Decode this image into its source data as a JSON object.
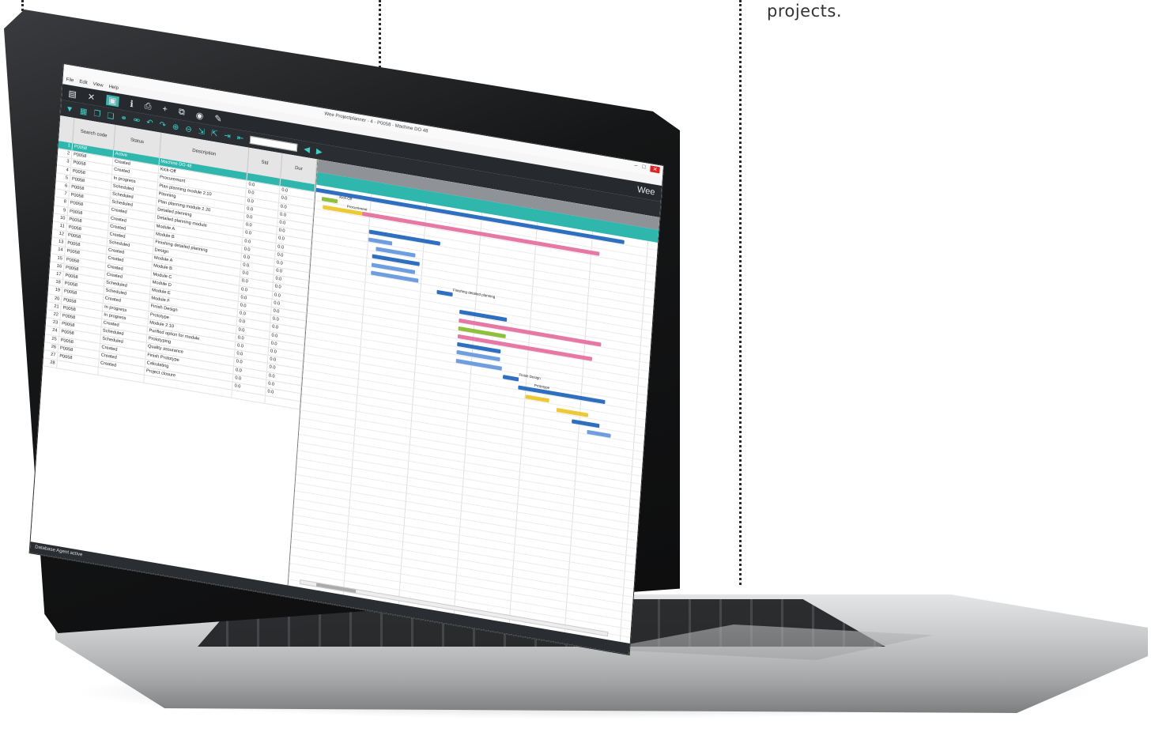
{
  "caption": {
    "tail_text": "projects."
  },
  "app": {
    "window_title": "Wee Projectplanner - 4 - P0058 - Machine DO 48",
    "brand": "Wee",
    "menu": [
      "File",
      "Edit",
      "View",
      "Help"
    ],
    "toolbar_primary": [
      "save",
      "close",
      "view",
      "info",
      "print",
      "add",
      "copy",
      "eye",
      "edit"
    ],
    "toolbar_secondary": [
      "filter",
      "table",
      "copy",
      "paste",
      "link",
      "unlink",
      "undo",
      "redo",
      "zoom-in",
      "zoom-out",
      "expand",
      "collapse",
      "indent",
      "outdent",
      "prev",
      "next"
    ],
    "search_placeholder": "",
    "columns": [
      "Search code",
      "Status",
      "Description",
      "Std",
      "Dur"
    ],
    "status_text": "Database Agent active",
    "rows": [
      {
        "no": "1",
        "id": "P0058",
        "status": "Active",
        "desc": "Machine DO 48",
        "d1": "",
        "d2": "",
        "active": true
      },
      {
        "no": "2",
        "id": "P0058",
        "status": "Created",
        "desc": "Kick-Off",
        "d1": "0.0",
        "d2": "0.0"
      },
      {
        "no": "3",
        "id": "P0058",
        "status": "Created",
        "desc": "Procurement",
        "d1": "0.0",
        "d2": "0.0"
      },
      {
        "no": "4",
        "id": "P0058",
        "status": "In progress",
        "desc": "Plan planning module 2.10",
        "d1": "0.0",
        "d2": "0.0"
      },
      {
        "no": "5",
        "id": "P0058",
        "status": "Scheduled",
        "desc": "Planning",
        "d1": "0.0",
        "d2": "0.0"
      },
      {
        "no": "6",
        "id": "P0058",
        "status": "Scheduled",
        "desc": "Plan planning module 2.20",
        "d1": "0.0",
        "d2": "0.0"
      },
      {
        "no": "7",
        "id": "P0058",
        "status": "Scheduled",
        "desc": "Detailed planning",
        "d1": "0.0",
        "d2": "0.0"
      },
      {
        "no": "8",
        "id": "P0058",
        "status": "Created",
        "desc": "Detailed planning module",
        "d1": "0.0",
        "d2": "0.0"
      },
      {
        "no": "9",
        "id": "P0058",
        "status": "Created",
        "desc": "Module A",
        "d1": "0.0",
        "d2": "0.0"
      },
      {
        "no": "10",
        "id": "P0058",
        "status": "Created",
        "desc": "Module B",
        "d1": "0.0",
        "d2": "0.0"
      },
      {
        "no": "11",
        "id": "P0058",
        "status": "Created",
        "desc": "Finishing detailed planning",
        "d1": "0.0",
        "d2": "0.0"
      },
      {
        "no": "12",
        "id": "P0058",
        "status": "Scheduled",
        "desc": "Design",
        "d1": "0.0",
        "d2": "0.0"
      },
      {
        "no": "13",
        "id": "P0058",
        "status": "Created",
        "desc": "Module A",
        "d1": "0.0",
        "d2": "0.0"
      },
      {
        "no": "14",
        "id": "P0058",
        "status": "Created",
        "desc": "Module B",
        "d1": "0.0",
        "d2": "0.0"
      },
      {
        "no": "15",
        "id": "P0058",
        "status": "Created",
        "desc": "Module C",
        "d1": "0.0",
        "d2": "0.0"
      },
      {
        "no": "16",
        "id": "P0058",
        "status": "Created",
        "desc": "Module D",
        "d1": "0.0",
        "d2": "0.0"
      },
      {
        "no": "17",
        "id": "P0058",
        "status": "Scheduled",
        "desc": "Module E",
        "d1": "0.0",
        "d2": "0.0"
      },
      {
        "no": "18",
        "id": "P0058",
        "status": "Scheduled",
        "desc": "Module F",
        "d1": "0.0",
        "d2": "0.0"
      },
      {
        "no": "19",
        "id": "P0058",
        "status": "Created",
        "desc": "Finish Design",
        "d1": "0.0",
        "d2": "0.0"
      },
      {
        "no": "20",
        "id": "P0058",
        "status": "In progress",
        "desc": "Prototype",
        "d1": "0.0",
        "d2": "0.0"
      },
      {
        "no": "21",
        "id": "P0058",
        "status": "In progress",
        "desc": "Module 2.10",
        "d1": "0.0",
        "d2": "0.0"
      },
      {
        "no": "22",
        "id": "P0058",
        "status": "Created",
        "desc": "Purified option for module",
        "d1": "0.0",
        "d2": "0.0"
      },
      {
        "no": "23",
        "id": "P0058",
        "status": "Scheduled",
        "desc": "Prototyping",
        "d1": "0.0",
        "d2": "0.0"
      },
      {
        "no": "24",
        "id": "P0058",
        "status": "Scheduled",
        "desc": "Quality assurance",
        "d1": "0.0",
        "d2": "0.0"
      },
      {
        "no": "25",
        "id": "P0058",
        "status": "Created",
        "desc": "Finish Prototype",
        "d1": "0.0",
        "d2": "0.0"
      },
      {
        "no": "26",
        "id": "P0058",
        "status": "Created",
        "desc": "Calculating",
        "d1": "0.0",
        "d2": "0.0"
      },
      {
        "no": "27",
        "id": "P0058",
        "status": "Created",
        "desc": "Project closure",
        "d1": "0.0",
        "d2": "0.0"
      },
      {
        "no": "28",
        "id": "",
        "status": "",
        "desc": "",
        "d1": "",
        "d2": ""
      }
    ],
    "gantt_labels": [
      "Kick-Off",
      "Procurement",
      "Finishing detailed planning",
      "Finish Design",
      "Prototype"
    ],
    "colors": {
      "accent": "#2fb7ad",
      "toolbar": "#262a2f",
      "bar_blue": "#2e6fc0",
      "bar_light_blue": "#6e9ee0",
      "bar_pink": "#e778a6",
      "bar_yellow": "#ecc935",
      "bar_green": "#8fbf3c"
    }
  }
}
